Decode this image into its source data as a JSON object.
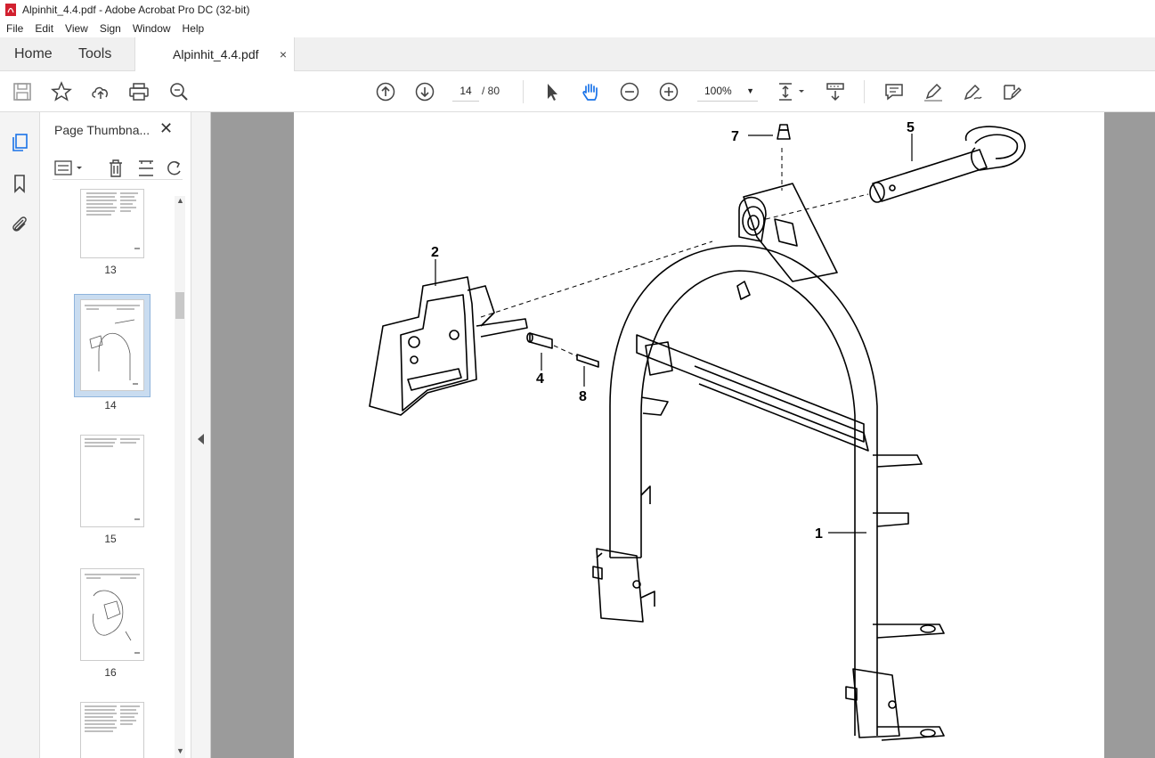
{
  "window": {
    "title": "Alpinhit_4.4.pdf - Adobe Acrobat Pro DC (32-bit)"
  },
  "menu": [
    "File",
    "Edit",
    "View",
    "Sign",
    "Window",
    "Help"
  ],
  "tabs": {
    "home": "Home",
    "tools": "Tools",
    "document": "Alpinhit_4.4.pdf",
    "close": "×"
  },
  "toolbar": {
    "page_current": "14",
    "page_total": "/ 80",
    "zoom": "100%"
  },
  "panel": {
    "title": "Page Thumbna...",
    "close": "✕",
    "thumbnails": [
      {
        "label": "13"
      },
      {
        "label": "14",
        "selected": true
      },
      {
        "label": "15"
      },
      {
        "label": "16"
      }
    ]
  },
  "drawing": {
    "callouts": [
      "7",
      "5",
      "2",
      "4",
      "8",
      "1"
    ]
  }
}
